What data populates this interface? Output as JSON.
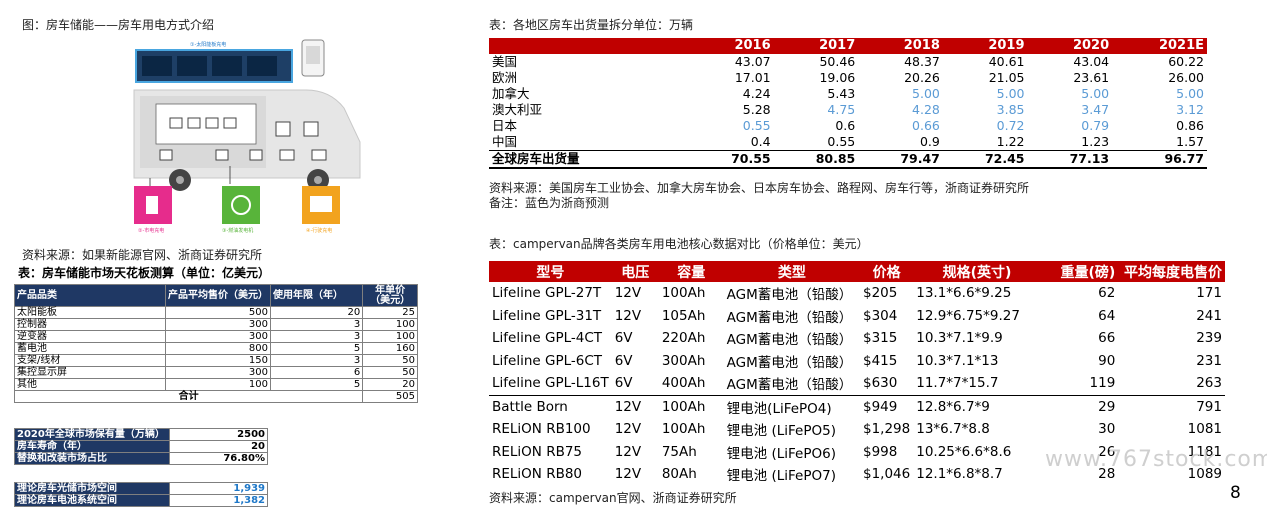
{
  "left": {
    "diagram_caption": "图：房车储能——房车用电方式介绍",
    "diagram_labels": {
      "solar": "①-太阳能板充电",
      "grid": "②-市电充电",
      "generator": "③-燃油发电机",
      "driving": "④-行驶充电"
    },
    "source1": "资料来源：如果新能源官网、浙商证券研究所",
    "table_title": "表：房车储能市场天花板测算（单位：亿美元）",
    "table_headers": [
      "产品品类",
      "产品平均售价（美元）",
      "使用年限（年）",
      "年单价（美元）"
    ],
    "rows": [
      [
        "太阳能板",
        "500",
        "20",
        "25"
      ],
      [
        "控制器",
        "300",
        "3",
        "100"
      ],
      [
        "逆变器",
        "300",
        "3",
        "100"
      ],
      [
        "蓄电池",
        "800",
        "5",
        "160"
      ],
      [
        "支架/线材",
        "150",
        "3",
        "50"
      ],
      [
        "集控显示屏",
        "300",
        "6",
        "50"
      ],
      [
        "其他",
        "100",
        "5",
        "20"
      ]
    ],
    "total_label": "合计",
    "total_value": "505",
    "market": [
      [
        "2020年全球市场保有量（万辆）",
        "2500"
      ],
      [
        "房车寿命（年）",
        "20"
      ],
      [
        "替换和改装市场占比",
        "76.80%"
      ]
    ],
    "space": [
      [
        "理论房车光储市场空间",
        "1,939"
      ],
      [
        "理论房车电池系统空间",
        "1,382"
      ]
    ]
  },
  "shipment": {
    "title": "表：各地区房车出货量拆分单位：万辆",
    "years": [
      "2016",
      "2017",
      "2018",
      "2019",
      "2020",
      "2021E"
    ],
    "rows": [
      {
        "region": "美国",
        "values": [
          "43.07",
          "50.46",
          "48.37",
          "40.61",
          "43.04",
          "60.22"
        ],
        "blue": [
          false,
          false,
          false,
          false,
          false,
          false
        ]
      },
      {
        "region": "欧洲",
        "values": [
          "17.01",
          "19.06",
          "20.26",
          "21.05",
          "23.61",
          "26.00"
        ],
        "blue": [
          false,
          false,
          false,
          false,
          false,
          false
        ]
      },
      {
        "region": "加拿大",
        "values": [
          "4.24",
          "5.43",
          "5.00",
          "5.00",
          "5.00",
          "5.00"
        ],
        "blue": [
          false,
          false,
          true,
          true,
          true,
          true
        ]
      },
      {
        "region": "澳大利亚",
        "values": [
          "5.28",
          "4.75",
          "4.28",
          "3.85",
          "3.47",
          "3.12"
        ],
        "blue": [
          false,
          true,
          true,
          true,
          true,
          true
        ]
      },
      {
        "region": "日本",
        "values": [
          "0.55",
          "0.6",
          "0.66",
          "0.72",
          "0.79",
          "0.86"
        ],
        "blue": [
          true,
          false,
          true,
          true,
          true,
          false
        ]
      },
      {
        "region": "中国",
        "values": [
          "0.4",
          "0.55",
          "0.9",
          "1.22",
          "1.23",
          "1.57"
        ],
        "blue": [
          false,
          false,
          false,
          false,
          false,
          false
        ]
      }
    ],
    "total": {
      "region": "全球房车出货量",
      "values": [
        "70.55",
        "80.85",
        "79.47",
        "72.45",
        "77.13",
        "96.77"
      ]
    },
    "source": "资料来源：美国房车工业协会、加拿大房车协会、日本房车协会、路程网、房车行等，浙商证券研究所",
    "note": "备注：蓝色为浙商预测",
    "blue_color": "#5b9bd5"
  },
  "battery": {
    "title": "表：campervan品牌各类房车用电池核心数据对比（价格单位：美元）",
    "headers": [
      "型号",
      "电压",
      "容量",
      "类型",
      "价格",
      "规格(英寸)",
      "重量(磅)",
      "平均每度电售价"
    ],
    "rows": [
      [
        "Lifeline GPL-27T",
        "12V",
        "100Ah",
        "AGM蓄电池（铅酸）",
        "$205",
        "13.1*6.6*9.25",
        "62",
        "171"
      ],
      [
        "Lifeline GPL-31T",
        "12V",
        "105Ah",
        "AGM蓄电池（铅酸）",
        "$304",
        "12.9*6.75*9.27",
        "64",
        "241"
      ],
      [
        "Lifeline GPL-4CT",
        "6V",
        "220Ah",
        "AGM蓄电池（铅酸）",
        "$315",
        "10.3*7.1*9.9",
        "66",
        "239"
      ],
      [
        "Lifeline GPL-6CT",
        "6V",
        "300Ah",
        "AGM蓄电池（铅酸）",
        "$415",
        "10.3*7.1*13",
        "90",
        "231"
      ],
      [
        "Lifeline GPL-L16T",
        "6V",
        "400Ah",
        "AGM蓄电池（铅酸）",
        "$630",
        "11.7*7*15.7",
        "119",
        "263"
      ],
      [
        "Battle Born",
        "12V",
        "100Ah",
        "锂电池(LiFePO4)",
        "$949",
        "12.8*6.7*9",
        "29",
        "791"
      ],
      [
        "RELiON RB100",
        "12V",
        "100Ah",
        "锂电池 (LiFePO5)",
        "$1,298",
        "13*6.7*8.8",
        "30",
        "1081"
      ],
      [
        "RELiON RB75",
        "12V",
        "75Ah",
        "锂电池 (LiFePO6)",
        "$998",
        "10.25*6.6*8.6",
        "26",
        "1181"
      ],
      [
        "RELiON RB80",
        "12V",
        "80Ah",
        "锂电池 (LiFePO7)",
        "$1,046",
        "12.1*6.8*8.7",
        "28",
        "1089"
      ]
    ],
    "source": "资料来源：campervan官网、浙商证券研究所",
    "accent": "#c00000"
  },
  "page_number": "8",
  "watermark": "www.767stock.com"
}
